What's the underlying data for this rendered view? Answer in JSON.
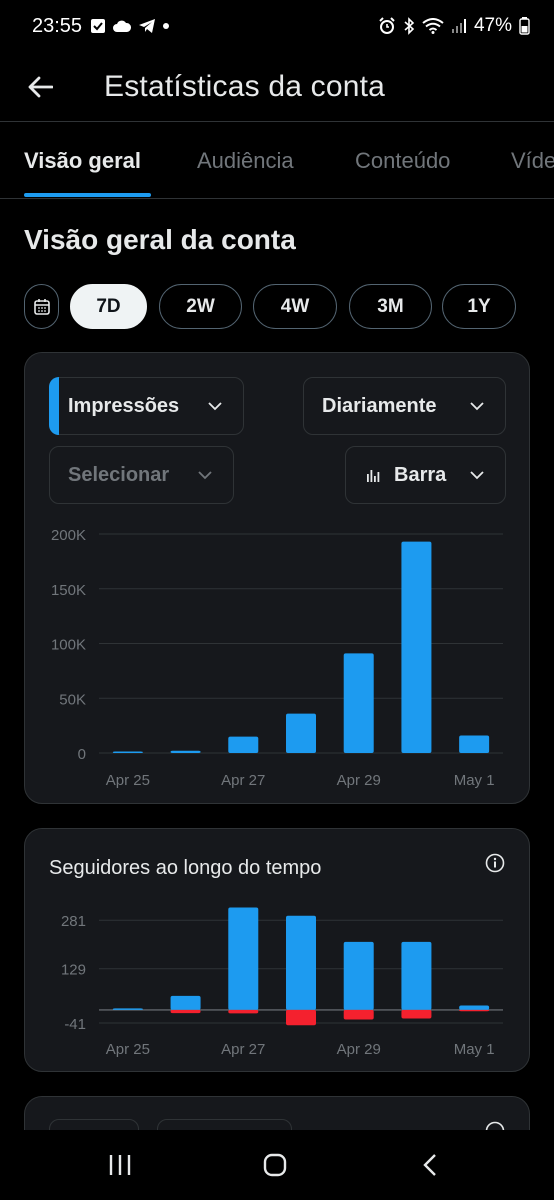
{
  "status_bar": {
    "time": "23:55",
    "battery": "47%",
    "left_icons": [
      "check-box-icon",
      "cloud-icon",
      "telegram-icon",
      "dot-icon"
    ],
    "right_icons": [
      "alarm-icon",
      "bluetooth-icon",
      "wifi-icon",
      "signal-icon",
      "battery-icon"
    ]
  },
  "header": {
    "title": "Estatísticas da conta"
  },
  "tabs": [
    {
      "label": "Visão geral",
      "active": true
    },
    {
      "label": "Audiência",
      "active": false
    },
    {
      "label": "Conteúdo",
      "active": false
    },
    {
      "label": "Víde",
      "active": false
    }
  ],
  "section_title": "Visão geral da conta",
  "ranges": [
    {
      "label": "7D",
      "selected": true
    },
    {
      "label": "2W",
      "selected": false
    },
    {
      "label": "4W",
      "selected": false
    },
    {
      "label": "3M",
      "selected": false
    },
    {
      "label": "1Y",
      "selected": false
    }
  ],
  "filters": {
    "metric": "Impressões",
    "interval": "Diariamente",
    "compare": "Selecionar",
    "chart_type": "Barra"
  },
  "colors": {
    "accent": "#1d9bf0",
    "negative": "#f4212e",
    "card": "#16181c",
    "border": "#2f3336",
    "muted": "#71767b"
  },
  "chart_data": [
    {
      "type": "bar",
      "title": "",
      "categories": [
        "Apr 25",
        "Apr 26",
        "Apr 27",
        "Apr 28",
        "Apr 29",
        "Apr 30",
        "May 1"
      ],
      "x_tick_labels": [
        "Apr 25",
        "Apr 27",
        "Apr 29",
        "May 1"
      ],
      "values": [
        1000,
        2000,
        15000,
        36000,
        91000,
        193000,
        16000
      ],
      "y_tick_labels": [
        "200K",
        "150K",
        "100K",
        "50K",
        "0"
      ],
      "y_ticks": [
        200000,
        150000,
        100000,
        50000,
        0
      ],
      "ylim": [
        0,
        200000
      ],
      "grid": true,
      "color": "#1d9bf0"
    },
    {
      "type": "bar",
      "title": "Seguidores ao longo do tempo",
      "categories": [
        "Apr 25",
        "Apr 26",
        "Apr 27",
        "Apr 28",
        "Apr 29",
        "Apr 30",
        "May 1"
      ],
      "x_tick_labels": [
        "Apr 25",
        "Apr 27",
        "Apr 29",
        "May 1"
      ],
      "series": [
        {
          "values": [
            2,
            44,
            321,
            295,
            213,
            213,
            14
          ],
          "color": "#1d9bf0"
        },
        {
          "values": [
            0,
            -10,
            -11,
            -48,
            -30,
            -27,
            -4
          ],
          "color": "#f4212e"
        }
      ],
      "y_tick_labels": [
        "281",
        "129",
        "-41"
      ],
      "y_ticks": [
        281,
        129,
        -41
      ],
      "ylim": [
        -41,
        335
      ],
      "grid": true
    }
  ]
}
